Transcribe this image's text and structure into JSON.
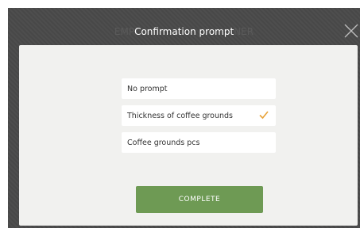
{
  "dialog": {
    "title_prefix_ghost": "EMP",
    "title": "Confirmation prompt",
    "title_suffix_ghost": "NER",
    "close_icon": "close-icon"
  },
  "options": [
    {
      "label": "No prompt",
      "selected": false
    },
    {
      "label": "Thickness of coffee grounds",
      "selected": true
    },
    {
      "label": "Coffee grounds pcs",
      "selected": false
    }
  ],
  "complete_label": "COMPLETE",
  "colors": {
    "accent_green": "#6e9a54",
    "check_orange": "#e8a33a",
    "dialog_bg": "#4a4a4a",
    "panel_bg": "#f1f1ef"
  }
}
